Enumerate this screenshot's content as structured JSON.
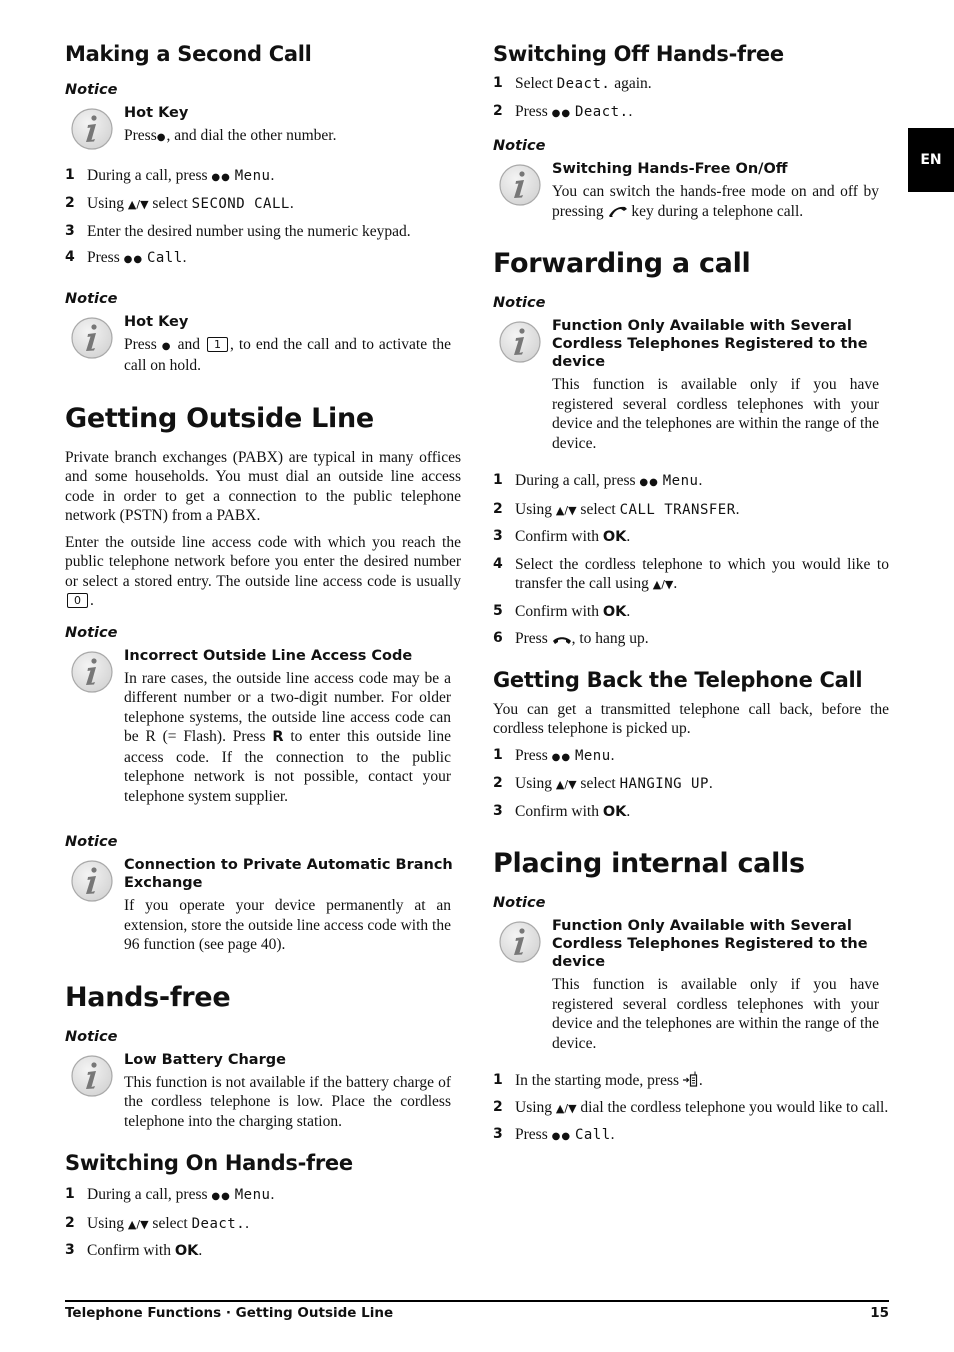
{
  "side_tab": "EN",
  "footer": {
    "section": "Telephone Functions · Getting Outside Line",
    "page_number": "15"
  },
  "notice_label": "Notice",
  "left": {
    "second_call": {
      "heading": "Making a Second Call",
      "notice1": {
        "title": "Hot Key",
        "body_pre": "Press",
        "body_post": ", and dial the other number."
      },
      "steps": [
        {
          "num": "1",
          "pre": "During a call, press",
          "lcd": "Menu",
          "post": "."
        },
        {
          "num": "2",
          "pre": "Using",
          "mid": "select",
          "lcd": "SECOND CALL",
          "post": "."
        },
        {
          "num": "3",
          "text": "Enter the desired number using the numeric keypad."
        },
        {
          "num": "4",
          "pre": "Press",
          "lcd": "Call",
          "post": "."
        }
      ],
      "notice2": {
        "title": "Hot Key",
        "body_pre": "Press",
        "body_mid": "and",
        "key": "1",
        "body_post": ", to end the call and to activate the call on hold."
      }
    },
    "outside_line": {
      "heading": "Getting Outside Line",
      "para1": "Private branch exchanges (PABX) are typical in many offices and some households. You must dial an outside line access code in order to get a connection to the public telephone network (PSTN) from a PABX.",
      "para2_pre": "Enter the outside line access code with which you reach the public telephone network before you enter the desired number or select a stored entry. The outside line access code is usually",
      "para2_key": "0",
      "para2_post": ".",
      "notice1": {
        "title": "Incorrect Outside Line Access Code",
        "body_pre": "In rare cases, the outside line access code may be a different number or a two-digit number. For older telephone systems, the outside line access code can be R (= Flash). Press",
        "body_key": "R",
        "body_post": "to enter this outside line access code. If the connection to the public telephone network is not possible, contact your telephone system supplier."
      },
      "notice2": {
        "title": "Connection to Private Automatic Branch Exchange",
        "body": "If you operate your device permanently at an extension, store the outside line access code with the 96 function (see page 40)."
      }
    },
    "hands_free": {
      "heading": "Hands-free",
      "notice": {
        "title": "Low Battery Charge",
        "body": "This function is not available if the battery charge of the cordless telephone is low. Place the cordless telephone into the charging station."
      },
      "on_heading": "Switching On Hands-free",
      "on_steps": [
        {
          "num": "1",
          "pre": "During a call, press",
          "lcd": "Menu",
          "post": "."
        },
        {
          "num": "2",
          "pre": "Using",
          "mid": "select",
          "lcd": "Deact.",
          "post": "."
        },
        {
          "num": "3",
          "pre": "Confirm with",
          "bold": "OK",
          "post": "."
        }
      ]
    }
  },
  "right": {
    "off": {
      "heading": "Switching Off Hands-free",
      "steps": [
        {
          "num": "1",
          "pre": "Select",
          "lcd": "Deact.",
          "post": "again."
        },
        {
          "num": "2",
          "pre": "Press",
          "lcd": "Deact.",
          "post": "."
        }
      ],
      "notice": {
        "title": "Switching Hands-Free On/Off",
        "body_pre": "You can switch the hands-free mode on and off by pressing",
        "body_post": "key during a telephone call."
      }
    },
    "forwarding": {
      "heading": "Forwarding a call",
      "notice": {
        "title": "Function Only Available with Several Cordless Telephones Registered to the device",
        "body": "This function is available only if you have registered several cordless telephones with your device and the telephones are within the range of the device."
      },
      "steps": [
        {
          "num": "1",
          "pre": "During a call, press",
          "lcd": "Menu",
          "post": "."
        },
        {
          "num": "2",
          "pre": "Using",
          "mid": "select",
          "lcd": "CALL TRANSFER",
          "post": "."
        },
        {
          "num": "3",
          "pre": "Confirm with",
          "bold": "OK",
          "post": "."
        },
        {
          "num": "4",
          "pre": "Select the cordless telephone to which you would like to transfer the call using",
          "post": "."
        },
        {
          "num": "5",
          "pre": "Confirm with",
          "bold": "OK",
          "post": "."
        },
        {
          "num": "6",
          "pre": "Press",
          "post": ", to hang up."
        }
      ]
    },
    "getting_back": {
      "heading": "Getting Back the Telephone Call",
      "para": "You can get a transmitted telephone call back, before the cordless telephone is picked up.",
      "steps": [
        {
          "num": "1",
          "pre": "Press",
          "lcd": "Menu",
          "post": "."
        },
        {
          "num": "2",
          "pre": "Using",
          "mid": "select",
          "lcd": "HANGING UP",
          "post": "."
        },
        {
          "num": "3",
          "pre": "Confirm with",
          "bold": "OK",
          "post": "."
        }
      ]
    },
    "internal": {
      "heading": "Placing internal calls",
      "notice": {
        "title": "Function Only Available with Several Cordless Telephones Registered to the device",
        "body": "This function is available only if you have registered several cordless telephones with your device and the telephones are within the range of the device."
      },
      "steps": [
        {
          "num": "1",
          "pre": "In the starting mode, press",
          "post": "."
        },
        {
          "num": "2",
          "pre": "Using",
          "post": "dial the cordless telephone you would like to call."
        },
        {
          "num": "3",
          "pre": "Press",
          "lcd": "Call",
          "post": "."
        }
      ]
    }
  },
  "glyphs": {
    "dot": "●",
    "dots": "●●",
    "arrows": "▲/▼"
  }
}
